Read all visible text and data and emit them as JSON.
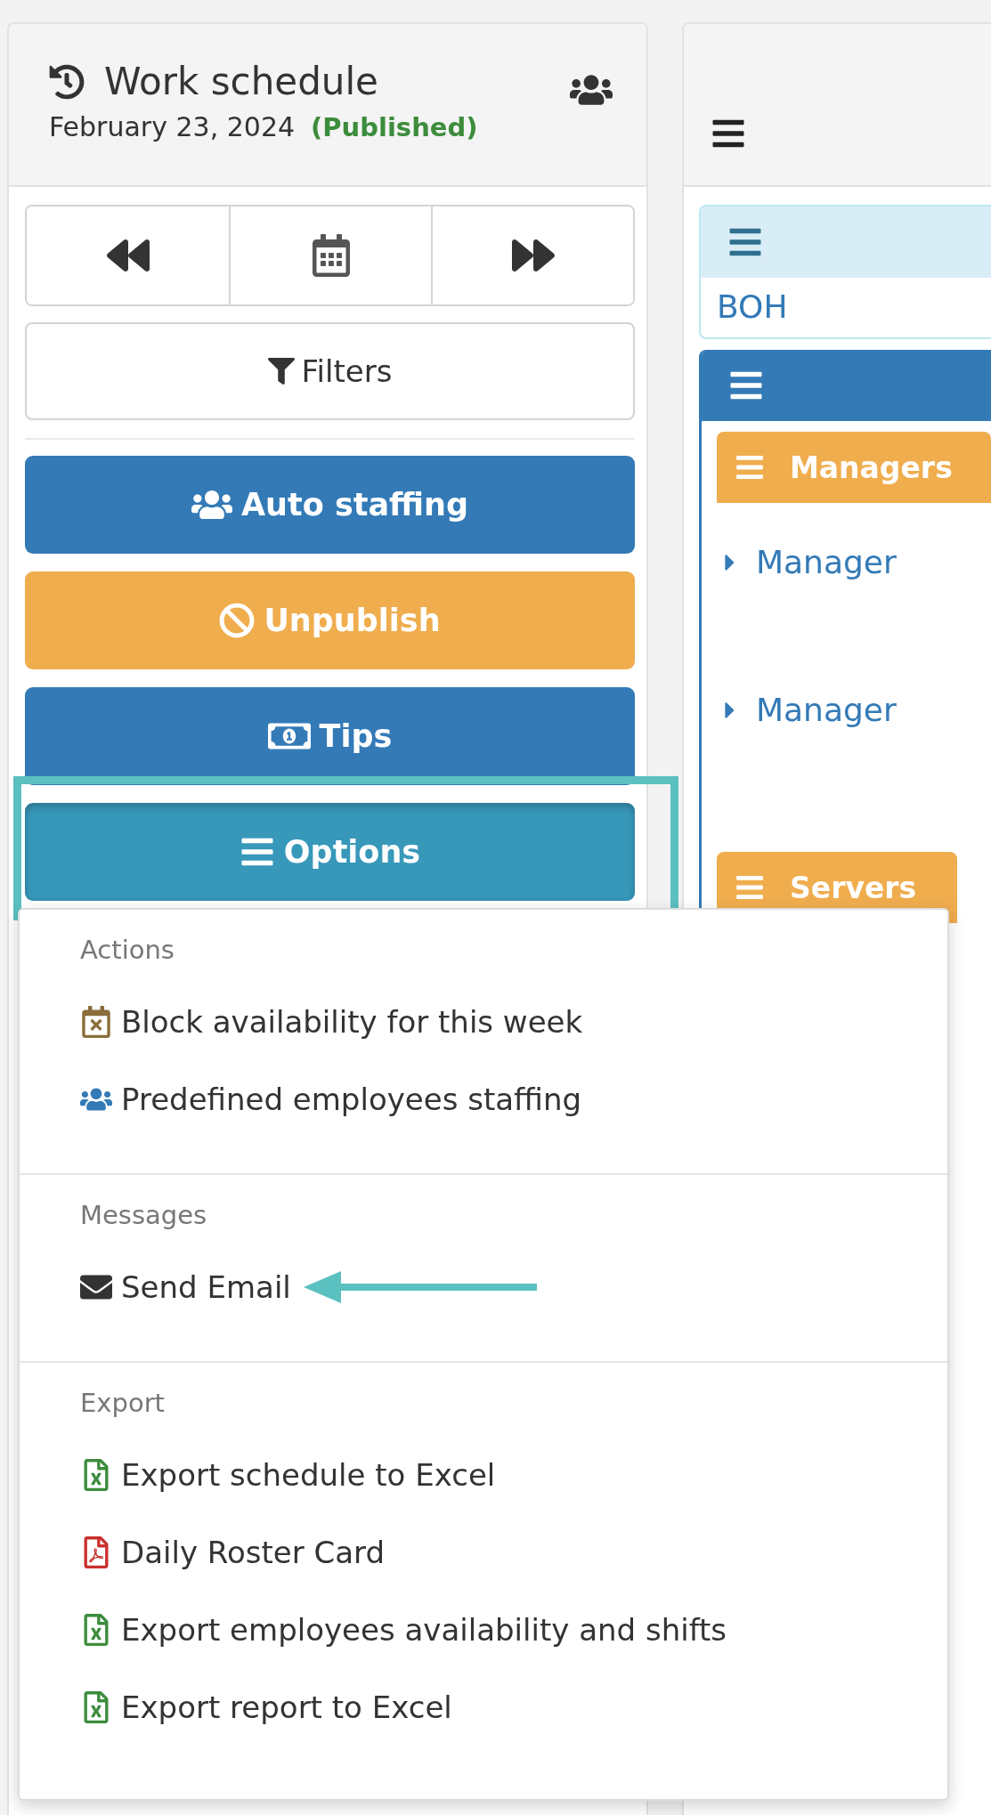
{
  "header": {
    "title": "Work schedule",
    "date": "February 23, 2024",
    "status": "(Published)"
  },
  "nav_buttons": [
    {
      "kind": "previous"
    },
    {
      "kind": "calendar"
    },
    {
      "kind": "next"
    }
  ],
  "filters_button": {
    "label": "Filters"
  },
  "action_buttons": [
    {
      "label": "Auto staffing",
      "kind": "staffing",
      "expanded": false
    },
    {
      "label": "Unpublish",
      "kind": "unpublish",
      "expanded": false
    },
    {
      "label": "Tips",
      "kind": "tips",
      "expanded": false
    },
    {
      "label": "Options",
      "kind": "options",
      "expanded": true
    }
  ],
  "options_menu": {
    "sections": [
      {
        "heading": "Actions",
        "items": [
          {
            "label": "Block availability for this week",
            "kind": "block",
            "pointed": false
          },
          {
            "label": "Predefined employees staffing",
            "kind": "staffing",
            "pointed": false
          }
        ]
      },
      {
        "heading": "Messages",
        "items": [
          {
            "label": "Send Email",
            "kind": "email",
            "pointed": true
          }
        ]
      },
      {
        "heading": "Export",
        "items": [
          {
            "label": "Export schedule to Excel",
            "kind": "excel",
            "pointed": false
          },
          {
            "label": "Daily Roster Card",
            "kind": "pdf",
            "pointed": false
          },
          {
            "label": "Export employees availability and shifts",
            "kind": "excel",
            "pointed": false
          },
          {
            "label": "Export report to Excel",
            "kind": "excel",
            "pointed": false
          }
        ]
      }
    ]
  },
  "board": {
    "department": "BOH",
    "roles": [
      {
        "name": "Managers",
        "positions": [
          "Manager",
          "Manager"
        ]
      },
      {
        "name": "Servers"
      }
    ]
  }
}
